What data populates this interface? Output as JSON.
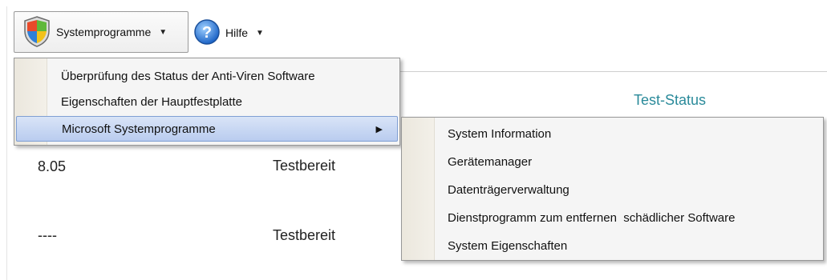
{
  "toolbar": {
    "system_programs_label": "Systemprogramme",
    "help_label": "Hilfe",
    "shield_icon": "windows-security-shield-icon",
    "help_icon": "question-mark-icon"
  },
  "table": {
    "column_test_status": "Test-Status",
    "rows": [
      {
        "value": "8.05",
        "status": "Testbereit"
      },
      {
        "value": "----",
        "status": "Testbereit"
      }
    ]
  },
  "menu": {
    "items": [
      {
        "label": "Überprüfung des Status der Anti-Viren Software"
      },
      {
        "label": "Eigenschaften der Hauptfestplatte"
      },
      {
        "label": "Microsoft Systemprogramme",
        "has_submenu": true
      }
    ]
  },
  "submenu": {
    "items": [
      {
        "label": "System Information"
      },
      {
        "label": "Gerätemanager"
      },
      {
        "label": "Datenträgerverwaltung"
      },
      {
        "label": "Dienstprogramm zum entfernen  schädlicher Software"
      },
      {
        "label": "System Eigenschaften"
      }
    ]
  },
  "colors": {
    "selection": "#b9ccef",
    "header_text": "#2a8a9a",
    "menu_background": "#f5f5f5"
  }
}
